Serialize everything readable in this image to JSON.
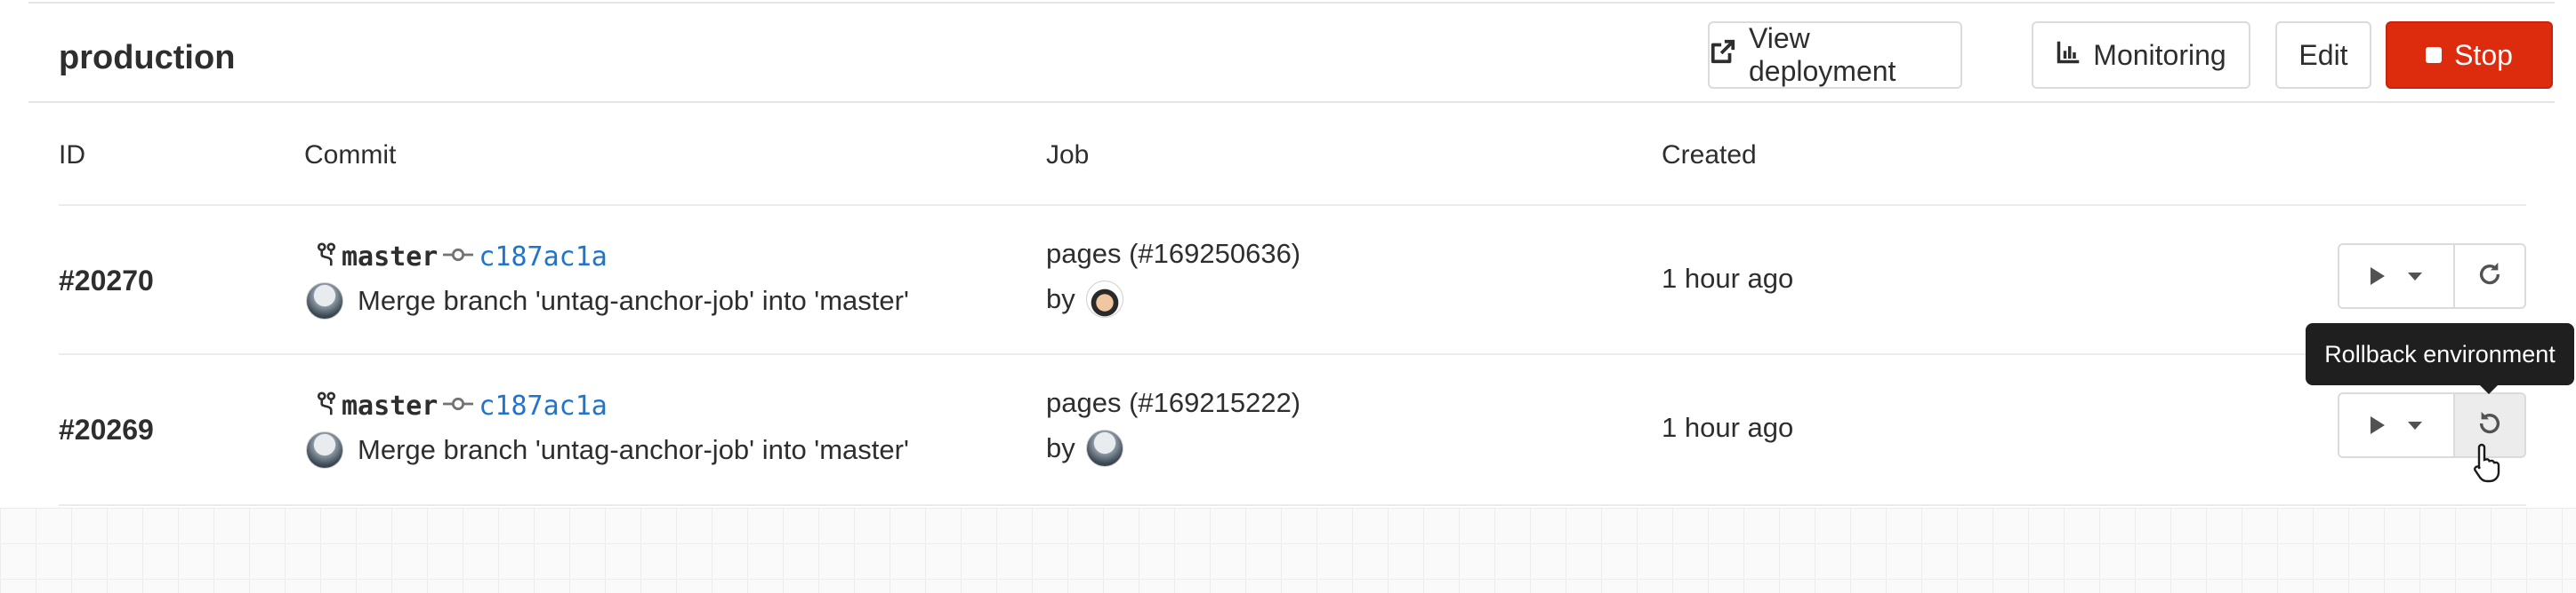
{
  "environment": {
    "name": "production",
    "buttons": {
      "view_deployment": "View deployment",
      "monitoring": "Monitoring",
      "edit": "Edit",
      "stop": "Stop"
    }
  },
  "table": {
    "headers": {
      "id": "ID",
      "commit": "Commit",
      "job": "Job",
      "created": "Created"
    },
    "rows": [
      {
        "id": "#20270",
        "ref": "master",
        "sha": "c187ac1a",
        "commit_title": "Merge branch 'untag-anchor-job' into 'master'",
        "job": "pages (#169250636)",
        "by": "by",
        "created": "1 hour ago",
        "action_icon": "retry-icon"
      },
      {
        "id": "#20269",
        "ref": "master",
        "sha": "c187ac1a",
        "commit_title": "Merge branch 'untag-anchor-job' into 'master'",
        "job": "pages (#169215222)",
        "by": "by",
        "created": "1 hour ago",
        "action_icon": "rollback-icon"
      }
    ]
  },
  "tooltip": {
    "text": "Rollback environment"
  },
  "colors": {
    "stop": "#dd2b0e",
    "sha_link": "#1f75cb",
    "tooltip_bg": "#1f1f1f"
  }
}
